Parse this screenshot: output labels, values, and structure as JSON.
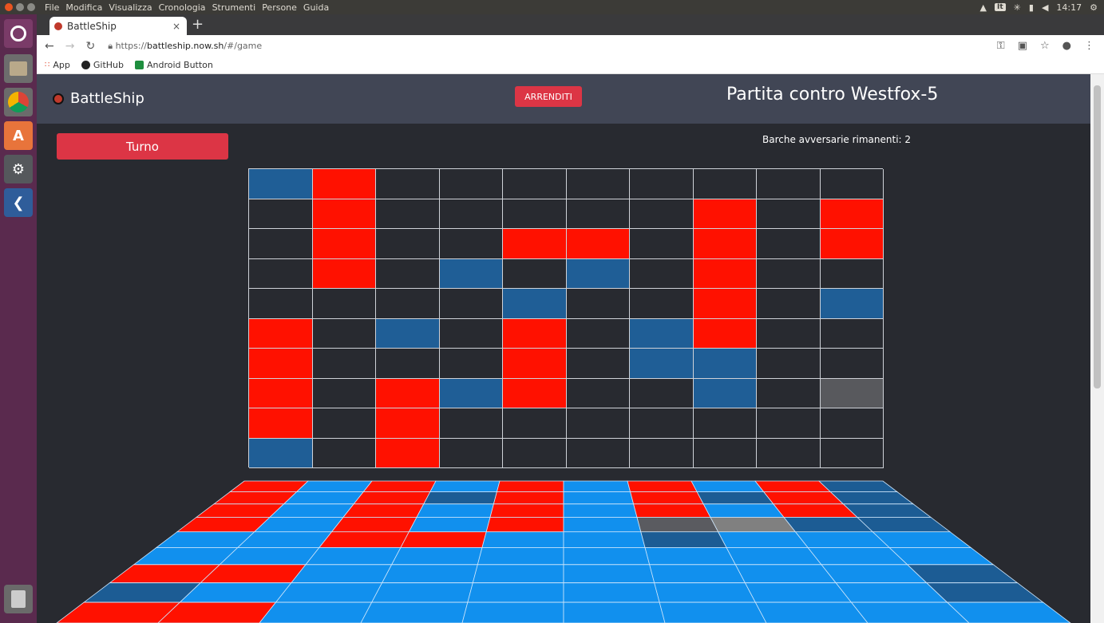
{
  "system_panel": {
    "menu": [
      "File",
      "Modifica",
      "Visualizza",
      "Cronologia",
      "Strumenti",
      "Persone",
      "Guida"
    ],
    "keyboard_layout": "It",
    "clock": "14:17"
  },
  "browser": {
    "tab_title": "BattleShip",
    "tab_close": "×",
    "new_tab": "+",
    "url_prefix": "https://",
    "url_host": "battleship.now.sh",
    "url_path": "/#/game",
    "bookmarks": [
      "App",
      "GitHub",
      "Android Button"
    ]
  },
  "app": {
    "brand": "BattleShip",
    "surrender_label": "ARRENDITI",
    "match_title": "Partita contro Westfox-5",
    "turn_label": "Turno",
    "remaining_label": "Barche avversarie rimanenti: 2"
  },
  "colors": {
    "hit": "#ff1100",
    "miss": "#1f5e96",
    "empty": "#282a30",
    "selected": "#58595d",
    "water": "#1190ee",
    "sunk_own": "#1c5c94",
    "miss_own": "#5a5b60",
    "miss_own_light": "#808080"
  },
  "opponent_grid_legend": {
    "H": "hit",
    "M": "miss",
    "S": "selected",
    ".": "empty"
  },
  "opponent_grid": [
    "MH........",
    ".H.....H.H",
    ".H..HH.H.H",
    ".H.M.M.H..",
    "....M..H.M",
    "H.M.H.MH..",
    "H...H.MM..",
    "H.HMH..M.S",
    "H.H.......",
    "M.H......."
  ],
  "own_grid_legend": {
    "H": "hit",
    "D": "sunk_own",
    "G": "miss_own",
    "L": "miss_own_light",
    ".": "water"
  },
  "own_grid": [
    "H.H.H.H.HD",
    "H.HDH.HDHD",
    "H.H.H.H.HD",
    "H.H.H.GLDD",
    "..HH..D...",
    "..........",
    "HH.......D",
    "D........D",
    "HH........"
  ]
}
